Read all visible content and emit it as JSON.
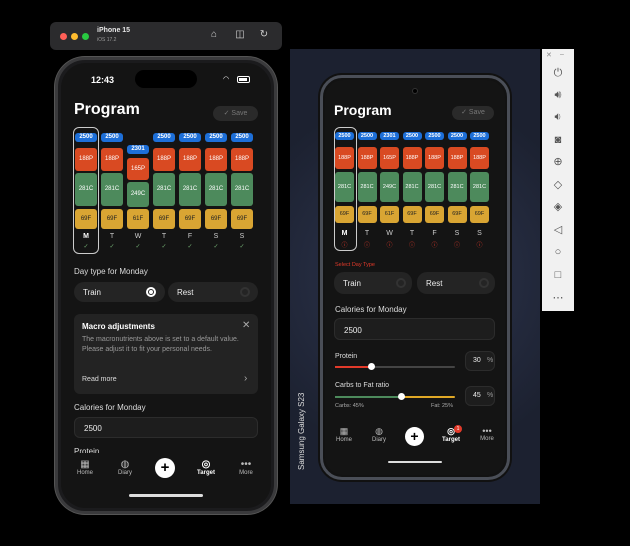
{
  "simulator": {
    "device": "iPhone 15",
    "os": "iOS 17.2"
  },
  "ios": {
    "time": "12:43",
    "title": "Program",
    "save": "Save",
    "days": [
      {
        "d": "M",
        "cal": "2500",
        "p": "188P",
        "c": "281C",
        "f": "69F"
      },
      {
        "d": "T",
        "cal": "2500",
        "p": "188P",
        "c": "281C",
        "f": "69F"
      },
      {
        "d": "W",
        "cal": "2301",
        "p": "165P",
        "c": "249C",
        "f": "61F"
      },
      {
        "d": "T",
        "cal": "2500",
        "p": "188P",
        "c": "281C",
        "f": "69F"
      },
      {
        "d": "F",
        "cal": "2500",
        "p": "188P",
        "c": "281C",
        "f": "69F"
      },
      {
        "d": "S",
        "cal": "2500",
        "p": "188P",
        "c": "281C",
        "f": "69F"
      },
      {
        "d": "S",
        "cal": "2500",
        "p": "188P",
        "c": "281C",
        "f": "69F"
      }
    ],
    "daytype_label": "Day type for Monday",
    "train": "Train",
    "rest": "Rest",
    "macro_title": "Macro adjustments",
    "macro_body": "The macronutrients above is set to a default value. Please adjust it to fit your personal needs.",
    "read_more": "Read more",
    "cal_label": "Calories for Monday",
    "cal_value": "2500",
    "partial": "Protein",
    "tabs": [
      "Home",
      "Diary",
      "",
      "Target",
      "More"
    ]
  },
  "android": {
    "title": "Program",
    "save": "Save",
    "device_label": "Samsung Galaxy S23",
    "select_label": "Select Day Type",
    "train": "Train",
    "rest": "Rest",
    "cal_label": "Calories for Monday",
    "cal_value": "2500",
    "protein_label": "Protein",
    "protein_value": "30",
    "protein_fraction": 0.3,
    "pct": "%",
    "ratio_label": "Carbs to Fat ratio",
    "ratio_value": "45",
    "ratio_fraction": 0.55,
    "carbs_text": "Carbs: 45%",
    "fat_text": "Fat: 25%",
    "badge": "1",
    "tabs": [
      "Home",
      "Diary",
      "",
      "Target",
      "More"
    ]
  },
  "colors": {
    "calorie": "#1d6fd8",
    "protein": "#d94a22",
    "carb": "#4d8a5c",
    "fat": "#d9a533",
    "accent_red": "#e23a2a"
  }
}
